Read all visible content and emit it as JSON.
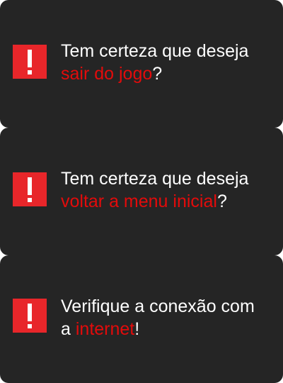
{
  "colors": {
    "panel_bg": "#252525",
    "text": "#ffffff",
    "highlight": "#e30b0b",
    "icon_bg": "#e8262a"
  },
  "dialogs": [
    {
      "icon": "exclamation-icon",
      "line1": "Tem certeza que deseja",
      "highlight": "sair do jogo",
      "suffix": "?"
    },
    {
      "icon": "exclamation-icon",
      "line1": "Tem certeza que deseja",
      "highlight": "voltar a menu inicial",
      "suffix": "?"
    },
    {
      "icon": "exclamation-icon",
      "line1": "Verifique a conexão com",
      "prefix": "a ",
      "highlight": "internet",
      "suffix": "!"
    }
  ]
}
